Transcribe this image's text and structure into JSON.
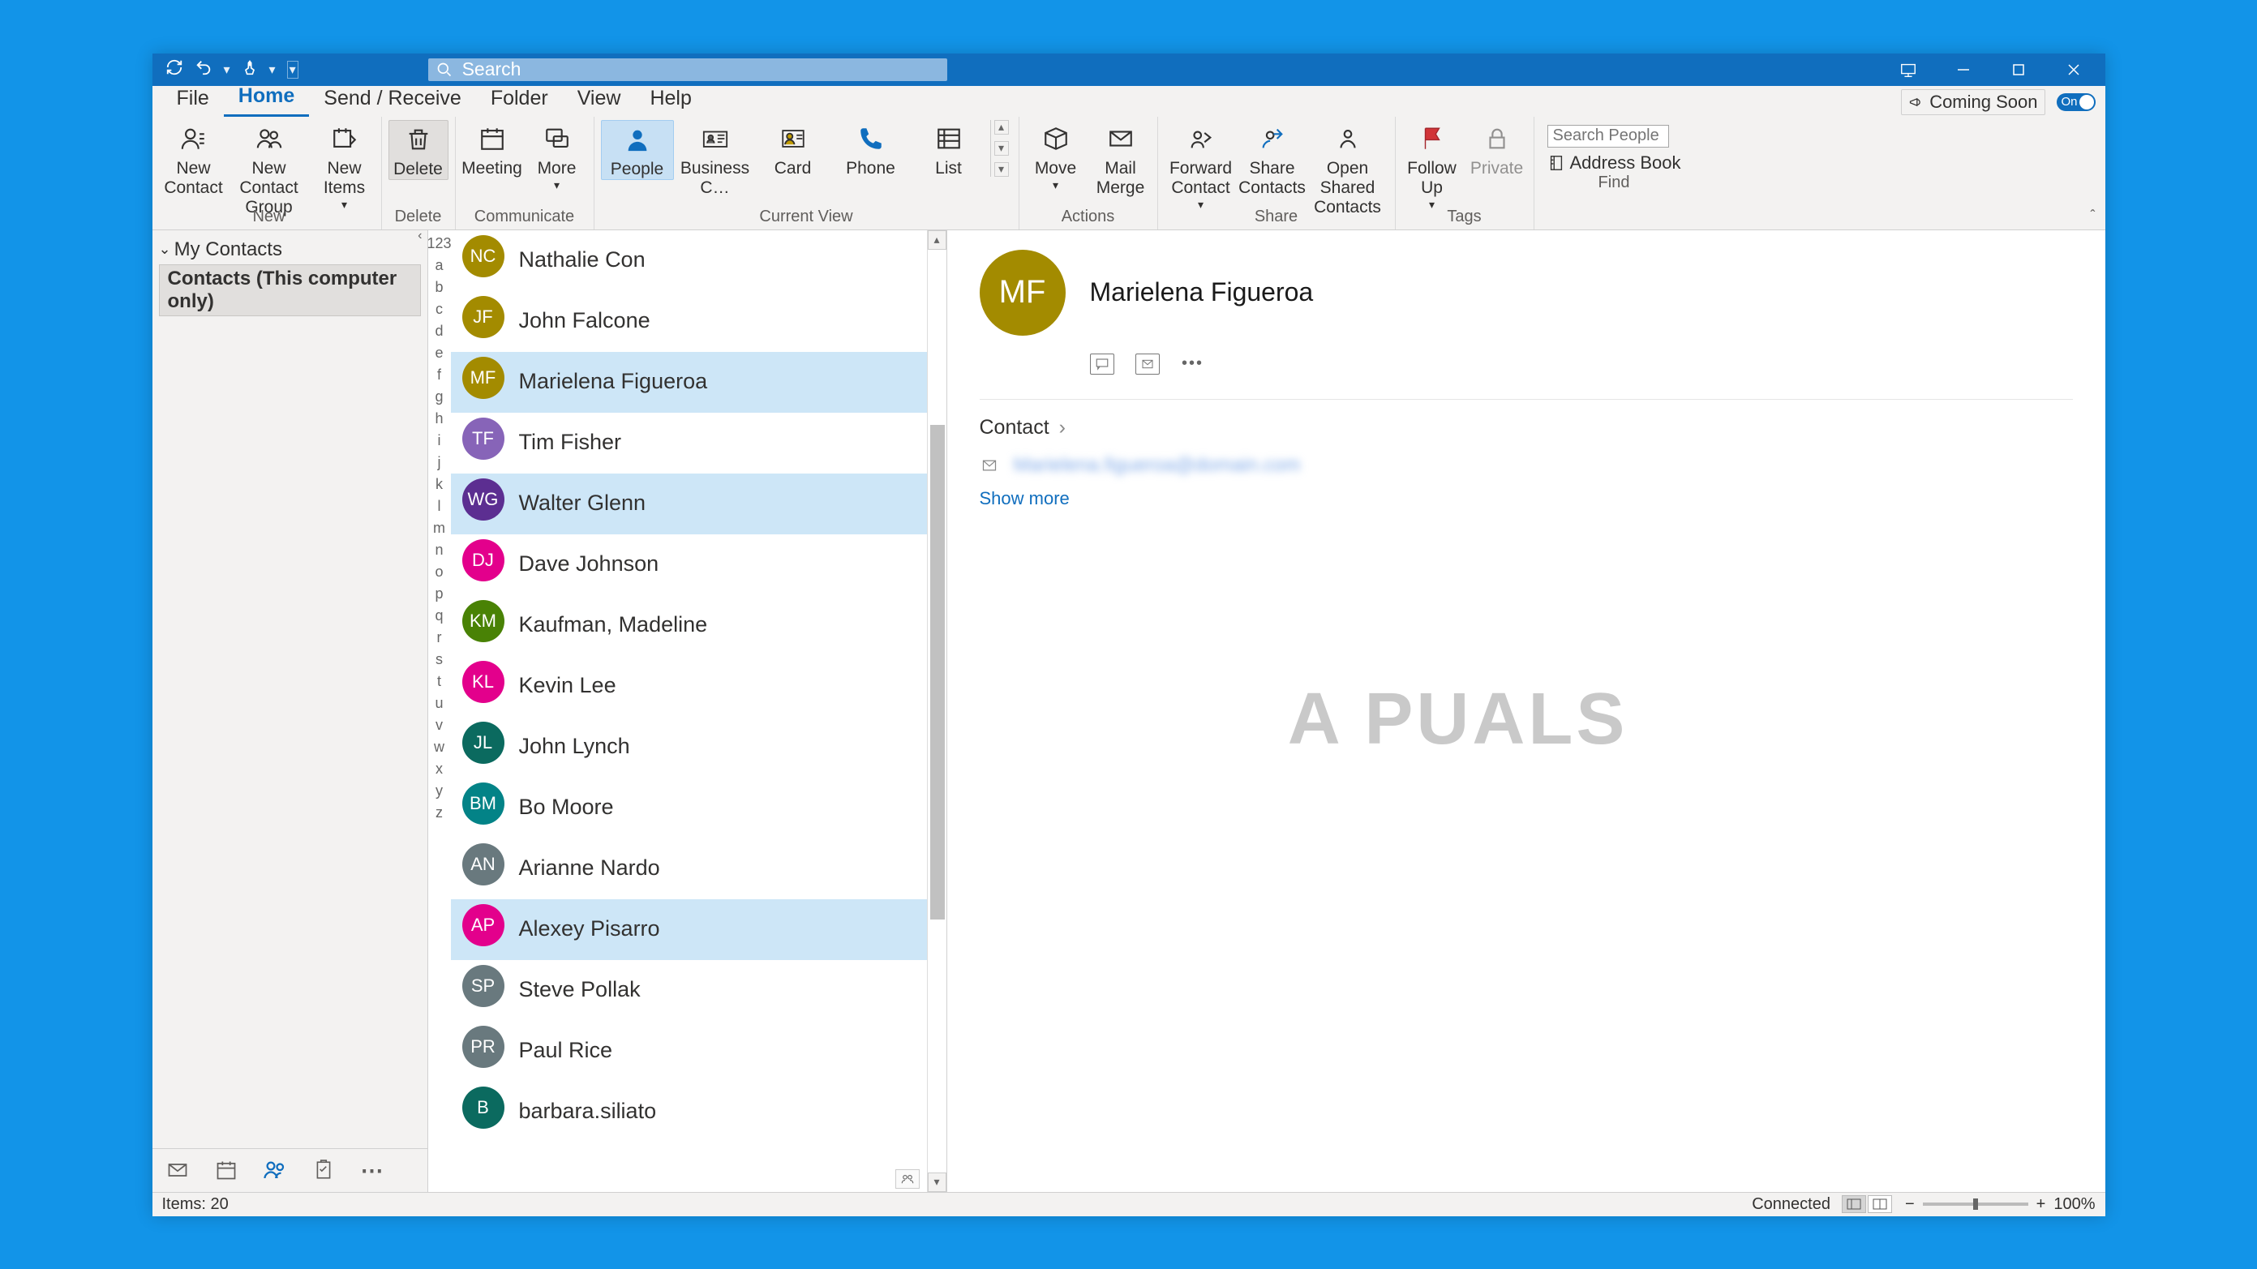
{
  "titlebar": {
    "search_placeholder": "Search"
  },
  "menu": {
    "tabs": [
      "File",
      "Home",
      "Send / Receive",
      "Folder",
      "View",
      "Help"
    ],
    "active": "Home",
    "coming_soon": "Coming Soon",
    "toggle": "On"
  },
  "ribbon": {
    "groups": {
      "new": {
        "label": "New",
        "items": [
          {
            "label": "New Contact",
            "name": "new-contact-button"
          },
          {
            "label": "New Contact Group",
            "name": "new-contact-group-button"
          },
          {
            "label": "New Items",
            "name": "new-items-button",
            "dropdown": true
          }
        ]
      },
      "delete": {
        "label": "Delete",
        "items": [
          {
            "label": "Delete",
            "name": "delete-button"
          }
        ]
      },
      "communicate": {
        "label": "Communicate",
        "items": [
          {
            "label": "Meeting",
            "name": "meeting-button"
          },
          {
            "label": "More",
            "name": "more-communicate-button",
            "dropdown": true
          }
        ]
      },
      "current_view": {
        "label": "Current View",
        "items": [
          {
            "label": "People",
            "name": "view-people-button",
            "selected": true
          },
          {
            "label": "Business C…",
            "name": "view-business-card-button"
          },
          {
            "label": "Card",
            "name": "view-card-button"
          },
          {
            "label": "Phone",
            "name": "view-phone-button"
          },
          {
            "label": "List",
            "name": "view-list-button"
          }
        ]
      },
      "actions": {
        "label": "Actions",
        "items": [
          {
            "label": "Move",
            "name": "move-button",
            "dropdown": true
          },
          {
            "label": "Mail Merge",
            "name": "mail-merge-button"
          }
        ]
      },
      "share": {
        "label": "Share",
        "items": [
          {
            "label": "Forward Contact",
            "name": "forward-contact-button",
            "dropdown": true
          },
          {
            "label": "Share Contacts",
            "name": "share-contacts-button"
          },
          {
            "label": "Open Shared Contacts",
            "name": "open-shared-contacts-button"
          }
        ]
      },
      "tags": {
        "label": "Tags",
        "items": [
          {
            "label": "Follow Up",
            "name": "follow-up-button",
            "dropdown": true
          },
          {
            "label": "Private",
            "name": "private-button"
          }
        ]
      },
      "find": {
        "label": "Find",
        "search_placeholder": "Search People",
        "address_book": "Address Book"
      }
    }
  },
  "nav": {
    "root": "My Contacts",
    "child": "Contacts (This computer only)"
  },
  "alpha_index": [
    "123",
    "a",
    "b",
    "c",
    "d",
    "e",
    "f",
    "g",
    "h",
    "i",
    "j",
    "k",
    "l",
    "m",
    "n",
    "o",
    "p",
    "q",
    "r",
    "s",
    "t",
    "u",
    "v",
    "w",
    "x",
    "y",
    "z"
  ],
  "contacts": [
    {
      "initials": "NC",
      "name": "Nathalie Con",
      "color": "#a38b00",
      "selected": false
    },
    {
      "initials": "JF",
      "name": "John Falcone",
      "color": "#a38b00",
      "selected": false
    },
    {
      "initials": "MF",
      "name": "Marielena Figueroa",
      "color": "#a38b00",
      "selected": true
    },
    {
      "initials": "TF",
      "name": "Tim Fisher",
      "color": "#8764b8",
      "selected": false
    },
    {
      "initials": "WG",
      "name": "Walter Glenn",
      "color": "#5c2e91",
      "selected": true
    },
    {
      "initials": "DJ",
      "name": "Dave Johnson",
      "color": "#e3008c",
      "selected": false
    },
    {
      "initials": "KM",
      "name": "Kaufman, Madeline",
      "color": "#498205",
      "selected": false
    },
    {
      "initials": "KL",
      "name": "Kevin Lee",
      "color": "#e3008c",
      "selected": false
    },
    {
      "initials": "JL",
      "name": "John Lynch",
      "color": "#0b6a5f",
      "selected": false
    },
    {
      "initials": "BM",
      "name": "Bo Moore",
      "color": "#038387",
      "selected": false
    },
    {
      "initials": "AN",
      "name": "Arianne Nardo",
      "color": "#69797e",
      "selected": false
    },
    {
      "initials": "AP",
      "name": "Alexey Pisarro",
      "color": "#e3008c",
      "selected": true
    },
    {
      "initials": "SP",
      "name": "Steve Pollak",
      "color": "#69797e",
      "selected": false
    },
    {
      "initials": "PR",
      "name": "Paul Rice",
      "color": "#69797e",
      "selected": false
    },
    {
      "initials": "B",
      "name": "barbara.siliato",
      "color": "#0b6a5f",
      "selected": false
    }
  ],
  "reading": {
    "name": "Marielena Figueroa",
    "initials": "MF",
    "avatar_color": "#a38b00",
    "section": "Contact",
    "email_masked": "Marielena.figueroa@domain.com",
    "show_more": "Show more"
  },
  "status": {
    "items": "Items: 20",
    "connected": "Connected",
    "zoom": "100%"
  },
  "watermark": "A   PUALS"
}
